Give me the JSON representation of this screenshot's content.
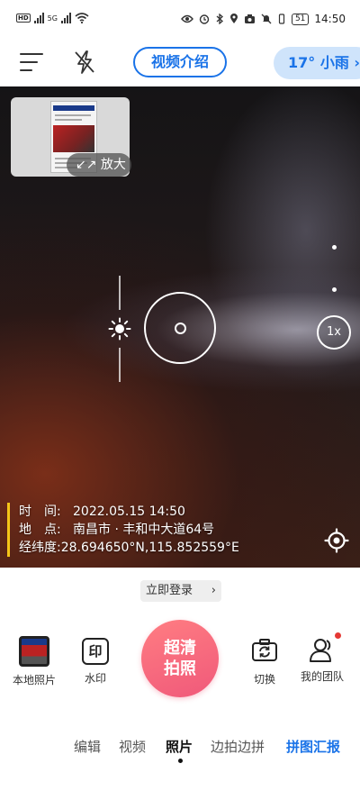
{
  "statusbar": {
    "network_hd": "HD",
    "network_5g": "5G",
    "battery": "51",
    "time": "14:50"
  },
  "topbar": {
    "video_intro": "视频介绍",
    "weather": "17° 小雨 ›"
  },
  "viewfinder": {
    "zoom_button": "↙↗ 放大",
    "zoom_level": "1x"
  },
  "watermark": {
    "time_label": "时　间:",
    "time_value": "2022.05.15 14:50",
    "place_label": "地　点:",
    "place_value": "南昌市 · 丰和中大道64号",
    "coord_label": "经纬度:",
    "coord_value": "28.694650°N,115.852559°E"
  },
  "bottom": {
    "login": "立即登录",
    "login_chevron": "›",
    "album": "本地照片",
    "watermark_glyph": "印",
    "watermark": "水印",
    "shutter_line1": "超清",
    "shutter_line2": "拍照",
    "switch": "切换",
    "team": "我的团队"
  },
  "modes": {
    "edit": "编辑",
    "video": "视频",
    "photo": "照片",
    "side_shoot": "边拍边拼",
    "collage": "拼图汇报"
  }
}
